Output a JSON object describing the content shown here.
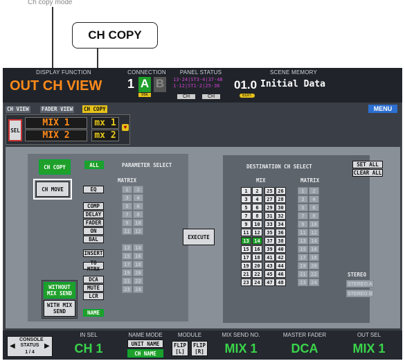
{
  "callout": {
    "top_caption": "Ch copy mode",
    "label": "CH COPY"
  },
  "header": {
    "display_function": {
      "label": "DISPLAY FUNCTION",
      "value": "OUT CH VIEW"
    },
    "connection": {
      "label": "CONNECTION",
      "num": "1",
      "a": "A",
      "b": "B",
      "sub": "96k"
    },
    "panel_status": {
      "label": "PANEL STATUS",
      "line1": "13-24|ST3-4|37-48",
      "line2": "1-12|ST1-2|25-36",
      "ch1": "CH",
      "ch2": "CH"
    },
    "scene_memory": {
      "label": "SCENE MEMORY",
      "number": "01.0",
      "title": "Initial Data",
      "edit": "EDIT"
    }
  },
  "tabs": {
    "ch_view": "CH VIEW",
    "fader_view": "FADER VIEW",
    "ch_copy": "CH COPY",
    "menu": "MENU"
  },
  "selector": {
    "sel": "SEL",
    "mix1": "MIX 1",
    "mix2": "MIX 2",
    "mx1": "mx 1",
    "mx2": "mx 2"
  },
  "left": {
    "ch_copy": "CH COPY",
    "ch_move": "CH MOVE",
    "without_mix_send": "WITHOUT MIX SEND",
    "with_mix_send": "WITH MIX SEND"
  },
  "param": {
    "all": "ALL",
    "title": "PARAMETER SELECT",
    "matrix_label": "MATRIX",
    "buttons": [
      "EQ",
      "COMP",
      "DELAY",
      "FADER",
      "ON",
      "BAL",
      "INSERT",
      "TO MTRX",
      "DCA",
      "MUTE",
      "LCR",
      "NAME"
    ]
  },
  "execute": "EXECUTE",
  "dest": {
    "title": "DESTINATION CH SELECT",
    "set_all": "SET ALL",
    "clear_all": "CLEAR ALL",
    "mix_label": "MIX",
    "matrix_label": "MATRIX",
    "stereo_label": "STEREO",
    "stereo_a": "STEREO A",
    "stereo_b": "STEREO B"
  },
  "statusbar": {
    "console_status": "CONSOLE STATUS",
    "page": "1 / 4",
    "in_sel_label": "IN SEL",
    "in_sel_value": "CH 1",
    "name_mode_label": "NAME MODE",
    "unit_name": "UNIT NAME",
    "ch_name": "CH NAME",
    "module_label": "MODULE",
    "flip_l": "FLIP [L]",
    "flip_r": "FLIP [R]",
    "mix_send_label": "MIX SEND NO.",
    "mix_send_value": "MIX 1",
    "master_label": "MASTER FADER",
    "master_value": "DCA",
    "out_sel_label": "OUT SEL",
    "out_sel_value": "MIX 1"
  }
}
